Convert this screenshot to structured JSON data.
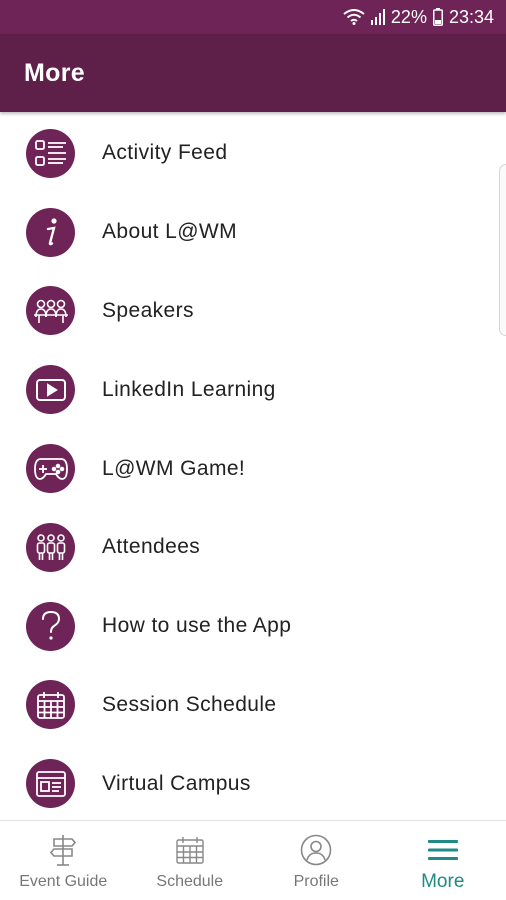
{
  "status_bar": {
    "battery": "22%",
    "time": "23:34"
  },
  "header": {
    "title": "More"
  },
  "menu": {
    "items": [
      {
        "label": "Activity Feed",
        "icon": "list-icon"
      },
      {
        "label": "About L@WM",
        "icon": "info-icon"
      },
      {
        "label": "Speakers",
        "icon": "speakers-icon"
      },
      {
        "label": "LinkedIn Learning",
        "icon": "video-play-icon"
      },
      {
        "label": "L@WM Game!",
        "icon": "gamepad-icon"
      },
      {
        "label": "Attendees",
        "icon": "attendees-icon"
      },
      {
        "label": "How to use the App",
        "icon": "question-icon"
      },
      {
        "label": "Session Schedule",
        "icon": "calendar-icon"
      },
      {
        "label": "Virtual Campus",
        "icon": "browser-window-icon"
      }
    ]
  },
  "bottom_nav": {
    "tabs": [
      {
        "label": "Event Guide",
        "icon": "signpost-icon"
      },
      {
        "label": "Schedule",
        "icon": "calendar-icon"
      },
      {
        "label": "Profile",
        "icon": "user-icon"
      },
      {
        "label": "More",
        "icon": "hamburger-icon"
      }
    ],
    "active": "More"
  },
  "colors": {
    "header_bg": "#5e2048",
    "status_bar_bg": "#6e2457",
    "icon_circle": "#6e2457",
    "active_tab": "#1f8a86",
    "inactive_tab": "#777777"
  }
}
